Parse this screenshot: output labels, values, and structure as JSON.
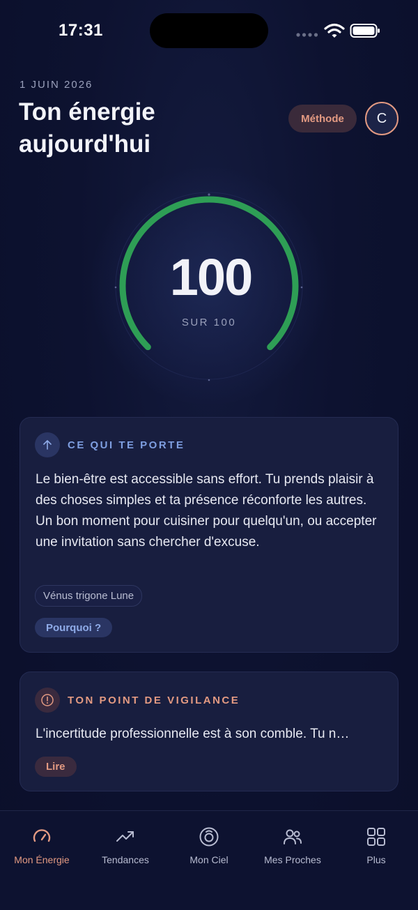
{
  "status_bar": {
    "time": "17:31"
  },
  "header": {
    "date": "1 JUIN 2026",
    "title": "Ton énergie aujourd'hui",
    "method_label": "Méthode",
    "avatar_initial": "C"
  },
  "gauge": {
    "value": "100",
    "subtitle": "SUR 100",
    "score": 100,
    "max": 100,
    "color": "#2e9e55"
  },
  "card_support": {
    "icon": "arrow-up-icon",
    "heading": "CE QUI TE PORTE",
    "text": "Le bien-être est accessible sans effort. Tu prends plaisir à des choses simples et ta présence réconforte les autres. Un bon moment pour cuisiner pour quelqu'un, ou accepter une invitation sans chercher d'excuse.",
    "tag": "Vénus trigone Lune",
    "button": "Pourquoi ?",
    "accent": "#7e9ee0"
  },
  "card_vigilance": {
    "icon": "alert-circle-icon",
    "heading": "TON POINT DE VIGILANCE",
    "text": "L'incertitude professionnelle est à son comble. Tu n…",
    "button": "Lire",
    "accent": "#e39a82"
  },
  "tab_bar": {
    "items": [
      {
        "label": "Mon Énergie",
        "icon": "gauge-icon",
        "active": true
      },
      {
        "label": "Tendances",
        "icon": "trending-up-icon",
        "active": false
      },
      {
        "label": "Mon Ciel",
        "icon": "sky-icon",
        "active": false
      },
      {
        "label": "Mes Proches",
        "icon": "users-icon",
        "active": false
      },
      {
        "label": "Plus",
        "icon": "grid-icon",
        "active": false
      }
    ]
  }
}
